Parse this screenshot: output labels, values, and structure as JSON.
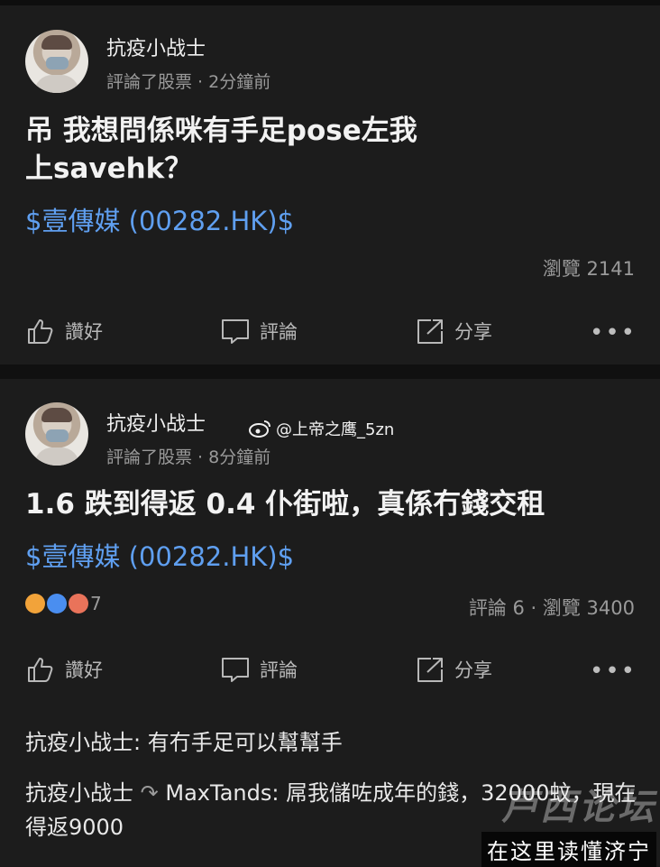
{
  "post1": {
    "username": "抗疫小战士",
    "meta": "評論了股票 · 2分鐘前",
    "content_line1": "吊 我想問係咪有手足pose左我",
    "content_line2": "上savehk？",
    "stock": "$壹傳媒 (00282.HK)$",
    "views": "瀏覽 2141",
    "actions": {
      "like": "讚好",
      "comment": "評論",
      "share": "分享"
    },
    "more": "•••"
  },
  "post2": {
    "username": "抗疫小战士",
    "meta": "評論了股票 · 8分鐘前",
    "content": "1.6 跌到得返 0.4 仆街啦，真係冇錢交租",
    "stock": "$壹傳媒 (00282.HK)$",
    "reaction_count": "7",
    "stats": "評論 6 · 瀏覽 3400",
    "actions": {
      "like": "讚好",
      "comment": "評論",
      "share": "分享"
    },
    "more": "•••"
  },
  "weibo_tag": "@上帝之鹰_5zn",
  "comments": [
    {
      "author": "抗疫小战士:",
      "text": " 有冇手足可以幫幫手"
    },
    {
      "author": "抗疫小战士",
      "reply_to": "MaxTands:",
      "text": " 屌我儲咗成年的錢，32000蚊，現在得返9000"
    }
  ],
  "watermark": {
    "line1": "芦西论坛",
    "line2": "在这里读懂济宁"
  },
  "colors": {
    "background": "#1c1c1c",
    "link": "#5f9ff0",
    "muted": "#9a9a9a"
  }
}
